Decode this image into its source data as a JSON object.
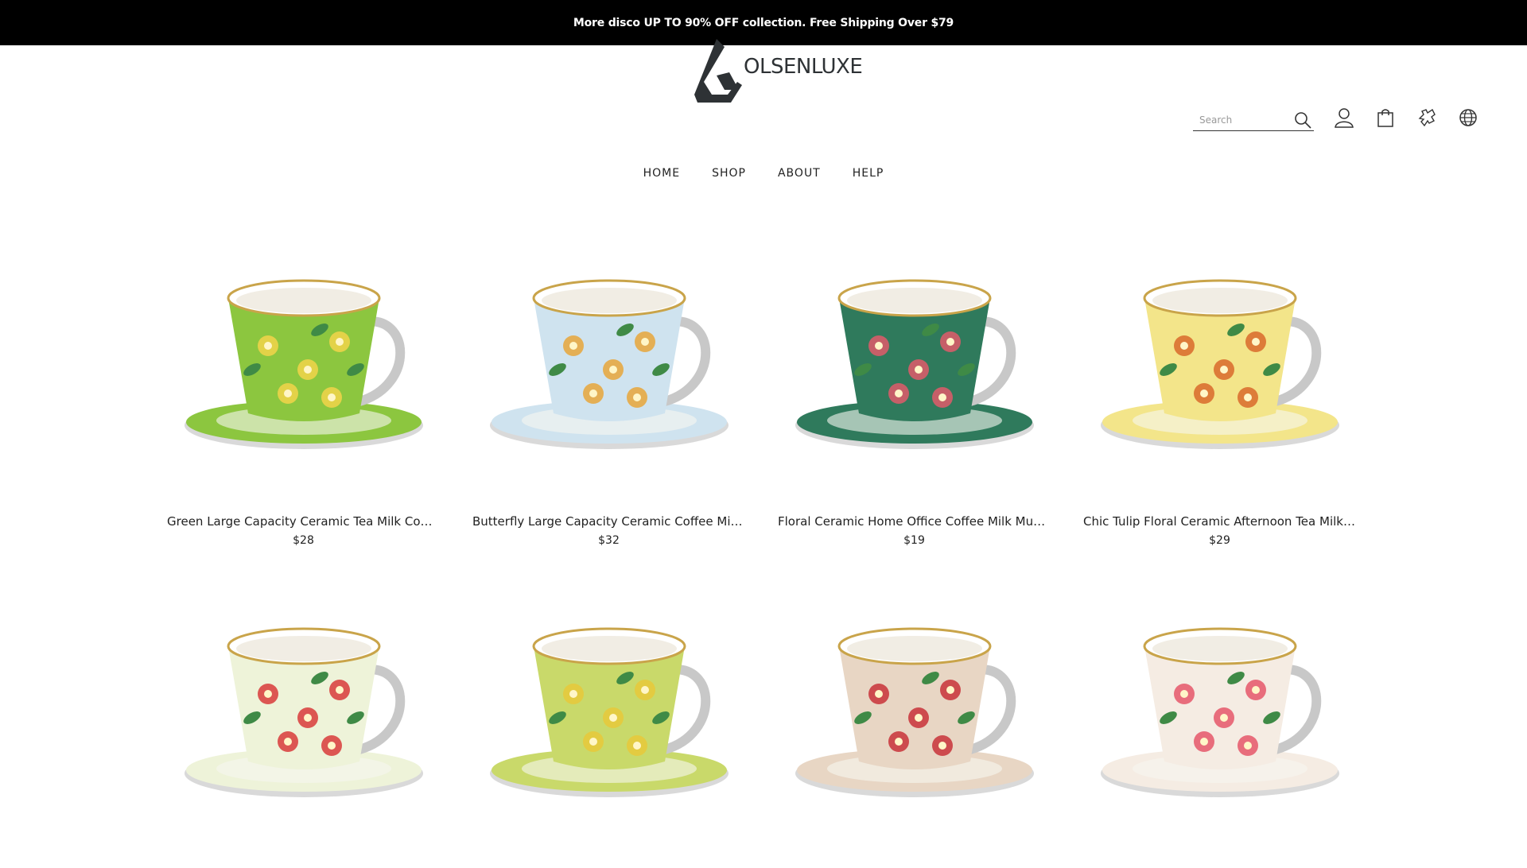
{
  "announcement": {
    "text": "More disco UP TO 90% OFF collection.  Free Shipping Over $79"
  },
  "brand": {
    "name": "OLSENLUXE"
  },
  "search": {
    "placeholder": "Search"
  },
  "header_icons": [
    "search-icon",
    "user-icon",
    "shopping-bag-icon",
    "puzzle-icon",
    "globe-icon"
  ],
  "nav": {
    "items": [
      "HOME",
      "SHOP",
      "ABOUT",
      "HELP"
    ]
  },
  "products": [
    {
      "title": "Green Large Capacity Ceramic Tea Milk Coffee J...",
      "price": "$28",
      "cup_color": "#8cc63f",
      "accent": "#f2d34a"
    },
    {
      "title": "Butterfly Large Capacity Ceramic Coffee Milk Br...",
      "price": "$32",
      "cup_color": "#cfe3ef",
      "accent": "#e7a63a"
    },
    {
      "title": "Floral Ceramic Home Office Coffee Milk Mug Te...",
      "price": "$19",
      "cup_color": "#2f7a5c",
      "accent": "#e05a6a"
    },
    {
      "title": "Chic Tulip Floral Ceramic Afternoon Tea Milk Coff...",
      "price": "$29",
      "cup_color": "#f3e58a",
      "accent": "#d86a2a"
    },
    {
      "title": "",
      "price": "",
      "cup_color": "#eef3d9",
      "accent": "#d83a3a"
    },
    {
      "title": "",
      "price": "",
      "cup_color": "#c9d96a",
      "accent": "#e8c83a"
    },
    {
      "title": "",
      "price": "",
      "cup_color": "#e8d6c4",
      "accent": "#c8323a"
    },
    {
      "title": "",
      "price": "",
      "cup_color": "#f5ece3",
      "accent": "#e5576a"
    }
  ]
}
